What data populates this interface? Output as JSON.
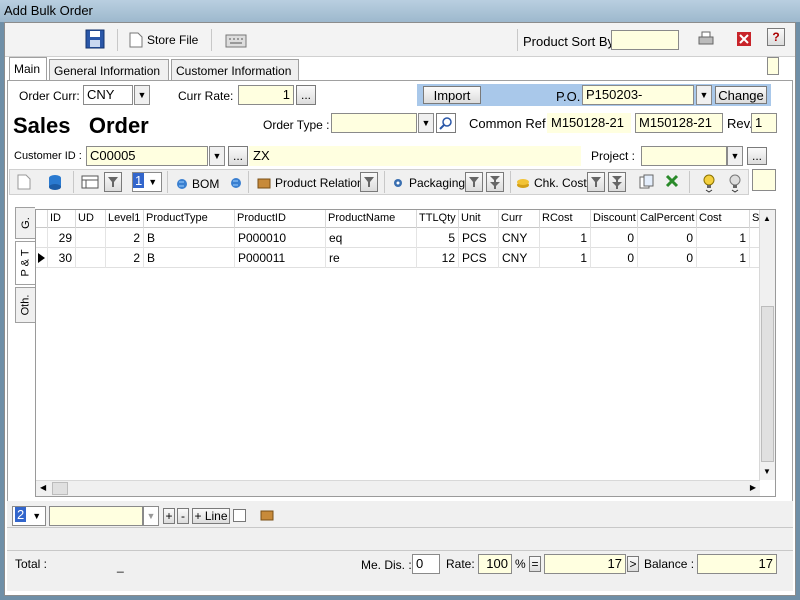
{
  "window": {
    "title": "Add Bulk Order"
  },
  "toolbar": {
    "save_icon": "floppy-icon",
    "store_file_label": "Store File",
    "keyboard_icon": "keyboard-icon",
    "product_sort_label": "Product Sort By",
    "product_sort_value": "",
    "print_icon": "printer-icon",
    "close_icon": "close-icon",
    "help_label": "?"
  },
  "tabs": [
    "Main",
    "General Information",
    "Customer Information"
  ],
  "order": {
    "curr_label": "Order Curr:",
    "curr_value": "CNY",
    "rate_label": "Curr Rate:",
    "rate_value": "1",
    "rate_btn": "...",
    "import_label": "Import",
    "po_label": "P.O.",
    "po_value": "P150203-",
    "change_label": "Change",
    "heading": "Sales   Order",
    "order_type_label": "Order Type :",
    "order_type_value": "",
    "common_ref_label": "Common Ref",
    "common_ref_value1": "M150128-21",
    "common_ref_value2": "M150128-21",
    "rev_label": "Rev.",
    "rev_value": "1",
    "customer_label": "Customer ID :",
    "customer_value": "C00005",
    "customer_btn": "...",
    "customer_name": "ZX",
    "project_label": "Project :",
    "project_value": "",
    "project_btn": "..."
  },
  "grid_toolbar": {
    "level_value": "1",
    "bom_label": "BOM",
    "product_relation_label": "Product Relation",
    "packaging_label": "Packaging",
    "chk_cost_label": "Chk. Cost"
  },
  "side_tabs": [
    "G.",
    "P & T",
    "Oth."
  ],
  "grid": {
    "columns": [
      "ID",
      "UD",
      "Level1",
      "ProductType",
      "ProductID",
      "ProductName",
      "TTLQty",
      "Unit",
      "Curr",
      "RCost",
      "Discount",
      "CalPercent",
      "Cost",
      "S"
    ],
    "rows": [
      {
        "selected": false,
        "cells": [
          "29",
          "",
          "2",
          "B",
          "P000010",
          "eq",
          "5",
          "PCS",
          "CNY",
          "1",
          "0",
          "0",
          "1"
        ]
      },
      {
        "selected": true,
        "cells": [
          "30",
          "",
          "2",
          "B",
          "P000011",
          "re",
          "12",
          "PCS",
          "CNY",
          "1",
          "0",
          "0",
          "1"
        ]
      }
    ]
  },
  "line_bar": {
    "count_value": "2",
    "plus_label": "+",
    "minus_label": "-",
    "add_line_label": "+ Line"
  },
  "footer": {
    "total_label": "Total :",
    "total_value": "_",
    "me_dis_label": "Me. Dis. :",
    "me_dis_value": "0",
    "rate_label": "Rate:",
    "rate_value": "100",
    "pct_label": "%",
    "eq_label": "=",
    "amount_value": "17",
    "arrow_label": ">",
    "balance_label": "Balance :",
    "balance_value": "17"
  }
}
